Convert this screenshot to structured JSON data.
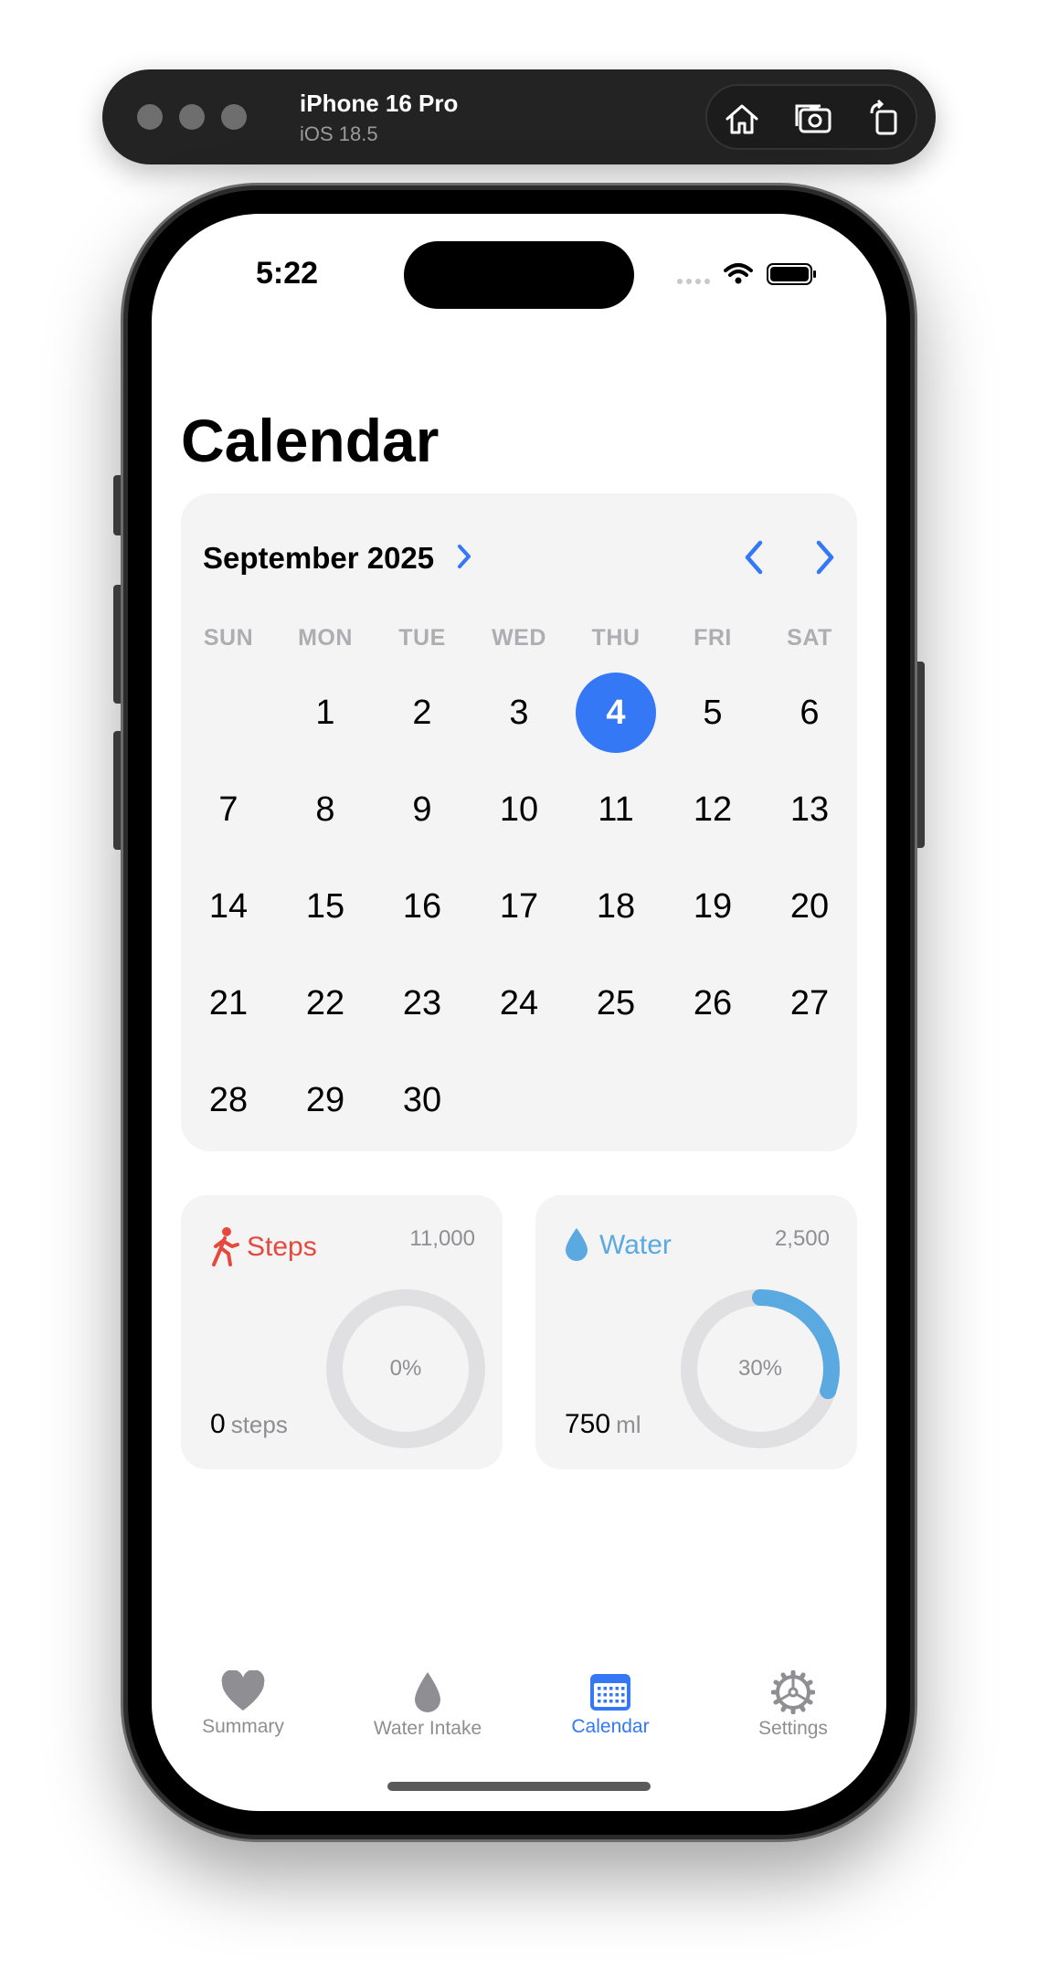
{
  "simulator": {
    "device_name": "iPhone 16 Pro",
    "os_version": "iOS 18.5"
  },
  "status_bar": {
    "time": "5:22"
  },
  "page": {
    "title": "Calendar"
  },
  "calendar": {
    "month_label": "September 2025",
    "weekdays": [
      "SUN",
      "MON",
      "TUE",
      "WED",
      "THU",
      "FRI",
      "SAT"
    ],
    "first_weekday_index": 1,
    "days_in_month": 30,
    "selected_day": 4,
    "accent_color": "#3478f6"
  },
  "stats": {
    "steps": {
      "label": "Steps",
      "goal": "11,000",
      "value": "0",
      "unit": "steps",
      "progress_label": "0%",
      "progress": 0,
      "color": "#e5493e"
    },
    "water": {
      "label": "Water",
      "goal": "2,500",
      "value": "750",
      "unit": "ml",
      "progress_label": "30%",
      "progress": 0.3,
      "color": "#5aa9e0"
    }
  },
  "tab_bar": {
    "tabs": [
      {
        "label": "Summary",
        "icon": "heart-icon"
      },
      {
        "label": "Water Intake",
        "icon": "drop-icon"
      },
      {
        "label": "Calendar",
        "icon": "calendar-icon"
      },
      {
        "label": "Settings",
        "icon": "gear-icon"
      }
    ],
    "active_index": 2
  }
}
